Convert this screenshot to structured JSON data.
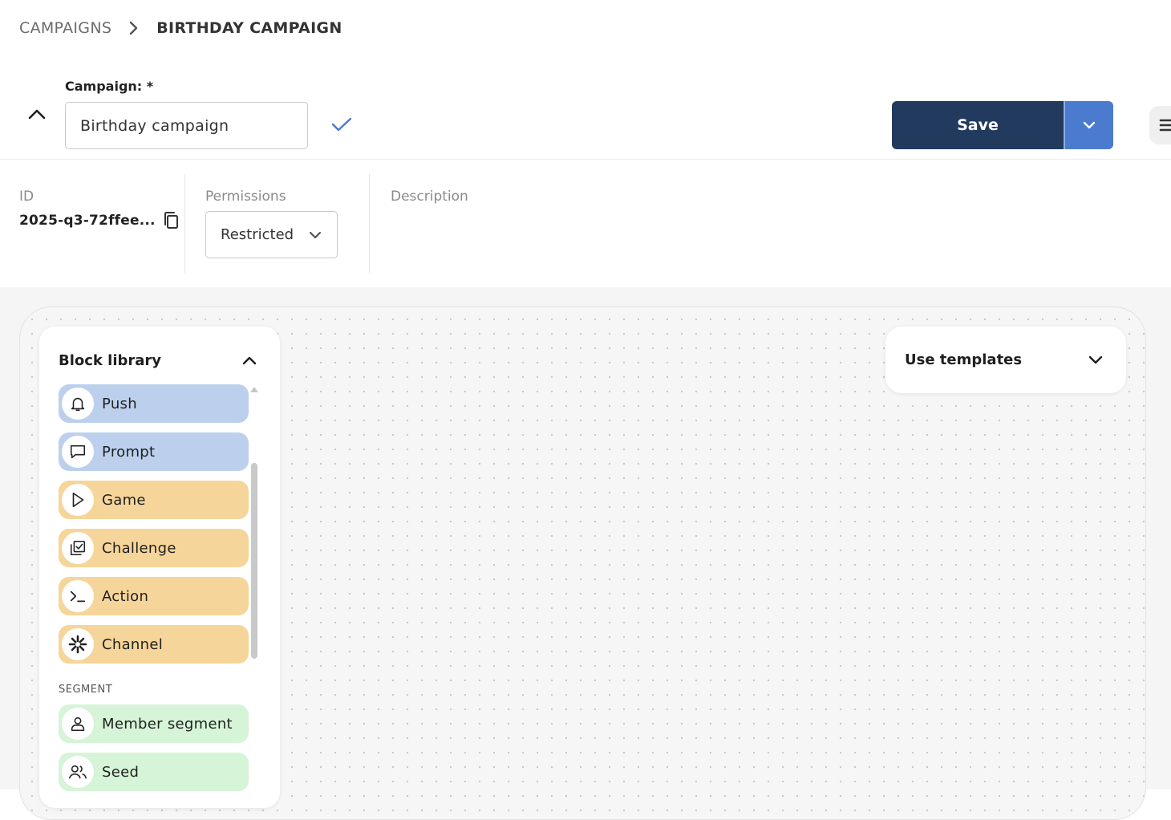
{
  "breadcrumb": {
    "parent": "CAMPAIGNS",
    "current": "BIRTHDAY CAMPAIGN"
  },
  "campaign": {
    "label": "Campaign: *",
    "value": "Birthday campaign"
  },
  "actions": {
    "save_label": "Save"
  },
  "meta": {
    "id_label": "ID",
    "id_value": "2025-q3-72ffee...",
    "permissions_label": "Permissions",
    "permissions_value": "Restricted",
    "description_label": "Description"
  },
  "library": {
    "title": "Block library",
    "blocks": [
      {
        "label": "Push",
        "icon": "bell-icon",
        "color": "#bcd0ee"
      },
      {
        "label": "Prompt",
        "icon": "message-icon",
        "color": "#bcd0ee"
      },
      {
        "label": "Game",
        "icon": "play-icon",
        "color": "#f6d59a"
      },
      {
        "label": "Challenge",
        "icon": "checklist-icon",
        "color": "#f6d59a"
      },
      {
        "label": "Action",
        "icon": "terminal-icon",
        "color": "#f6d59a"
      },
      {
        "label": "Channel",
        "icon": "asterisk-icon",
        "color": "#f6d59a"
      }
    ],
    "segment_label": "SEGMENT",
    "segment_blocks": [
      {
        "label": "Member segment",
        "icon": "user-icon",
        "color": "#d6f4d7"
      },
      {
        "label": "Seed",
        "icon": "users-icon",
        "color": "#d6f4d7"
      }
    ]
  },
  "templates": {
    "label": "Use templates"
  },
  "colors": {
    "primary": "#223a5e",
    "accent": "#4b7bcf"
  }
}
